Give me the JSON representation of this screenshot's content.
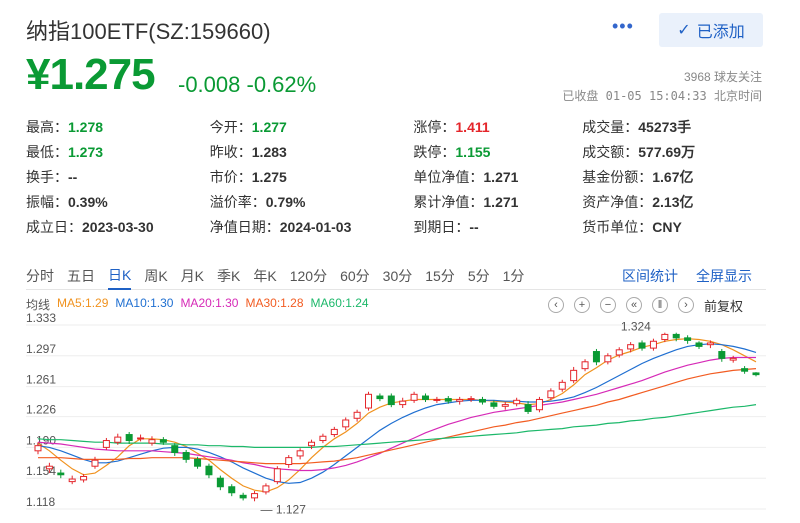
{
  "header": {
    "title": "纳指100ETF(SZ:159660)",
    "more_label": "•••",
    "added_label": "已添加",
    "price": "¥1.275",
    "change": "-0.008  -0.62%",
    "followers": "3968 球友关注",
    "status": "已收盘 01-05 15:04:33 北京时间"
  },
  "stats": [
    [
      {
        "l": "最高：",
        "v": "1.278",
        "c": "green"
      },
      {
        "l": "今开：",
        "v": "1.277",
        "c": "green"
      },
      {
        "l": "涨停：",
        "v": "1.411",
        "c": "red"
      },
      {
        "l": "成交量：",
        "v": "45273手",
        "c": ""
      }
    ],
    [
      {
        "l": "最低：",
        "v": "1.273",
        "c": "green"
      },
      {
        "l": "昨收：",
        "v": "1.283",
        "c": ""
      },
      {
        "l": "跌停：",
        "v": "1.155",
        "c": "green"
      },
      {
        "l": "成交额：",
        "v": "577.69万",
        "c": ""
      }
    ],
    [
      {
        "l": "换手：",
        "v": "--",
        "c": ""
      },
      {
        "l": "市价：",
        "v": "1.275",
        "c": ""
      },
      {
        "l": "单位净值：",
        "v": "1.271",
        "c": ""
      },
      {
        "l": "基金份额：",
        "v": "1.67亿",
        "c": ""
      }
    ],
    [
      {
        "l": "振幅：",
        "v": "0.39%",
        "c": ""
      },
      {
        "l": "溢价率：",
        "v": "0.79%",
        "c": ""
      },
      {
        "l": "累计净值：",
        "v": "1.271",
        "c": ""
      },
      {
        "l": "资产净值：",
        "v": "2.13亿",
        "c": ""
      }
    ],
    [
      {
        "l": "成立日：",
        "v": "2023-03-30",
        "c": ""
      },
      {
        "l": "净值日期：",
        "v": "2024-01-03",
        "c": ""
      },
      {
        "l": "到期日：",
        "v": "--",
        "c": ""
      },
      {
        "l": "货币单位：",
        "v": "CNY",
        "c": ""
      }
    ]
  ],
  "tabs": [
    "分时",
    "五日",
    "日K",
    "周K",
    "月K",
    "季K",
    "年K",
    "120分",
    "60分",
    "30分",
    "15分",
    "5分",
    "1分"
  ],
  "active_tab": 2,
  "tab_links": {
    "interval_stats": "区间统计",
    "fullscreen": "全屏显示"
  },
  "legend": [
    {
      "label": "均线",
      "color": "#555555"
    },
    {
      "label": "MA5:1.29",
      "color": "#f0921e"
    },
    {
      "label": "MA10:1.30",
      "color": "#1f6fd1"
    },
    {
      "label": "MA20:1.30",
      "color": "#d62ab7"
    },
    {
      "label": "MA30:1.28",
      "color": "#f25c22"
    },
    {
      "label": "MA60:1.24",
      "color": "#1cb86a"
    }
  ],
  "tools": {
    "prev": "‹",
    "zoom_in": "+",
    "zoom_out": "−",
    "start": "«",
    "pause": "‖",
    "next": "›",
    "adjust": "前复权"
  },
  "chart_data": {
    "type": "candlestick",
    "y_ticks": [
      "1.333",
      "1.297",
      "1.261",
      "1.226",
      "1.190",
      "1.154",
      "1.118"
    ],
    "ylim": [
      1.118,
      1.333
    ],
    "annotations": [
      {
        "label": "1.324",
        "value": 1.324
      },
      {
        "label": "1.127",
        "value": 1.127
      }
    ],
    "candles": [
      [
        1.186,
        1.192,
        1.182,
        1.196
      ],
      [
        1.165,
        1.168,
        1.16,
        1.172
      ],
      [
        1.16,
        1.158,
        1.154,
        1.164
      ],
      [
        1.15,
        1.153,
        1.147,
        1.157
      ],
      [
        1.152,
        1.156,
        1.149,
        1.159
      ],
      [
        1.168,
        1.175,
        1.165,
        1.179
      ],
      [
        1.19,
        1.198,
        1.187,
        1.201
      ],
      [
        1.196,
        1.202,
        1.193,
        1.206
      ],
      [
        1.205,
        1.198,
        1.194,
        1.208
      ],
      [
        1.2,
        1.201,
        1.197,
        1.205
      ],
      [
        1.195,
        1.199,
        1.192,
        1.203
      ],
      [
        1.199,
        1.196,
        1.193,
        1.202
      ],
      [
        1.192,
        1.184,
        1.18,
        1.195
      ],
      [
        1.184,
        1.176,
        1.172,
        1.187
      ],
      [
        1.176,
        1.168,
        1.165,
        1.179
      ],
      [
        1.168,
        1.158,
        1.154,
        1.171
      ],
      [
        1.154,
        1.144,
        1.14,
        1.157
      ],
      [
        1.144,
        1.137,
        1.133,
        1.147
      ],
      [
        1.134,
        1.131,
        1.128,
        1.137
      ],
      [
        1.131,
        1.136,
        1.127,
        1.139
      ],
      [
        1.138,
        1.145,
        1.135,
        1.148
      ],
      [
        1.15,
        1.165,
        1.147,
        1.168
      ],
      [
        1.17,
        1.178,
        1.166,
        1.181
      ],
      [
        1.18,
        1.186,
        1.176,
        1.189
      ],
      [
        1.192,
        1.196,
        1.188,
        1.199
      ],
      [
        1.198,
        1.203,
        1.195,
        1.206
      ],
      [
        1.205,
        1.211,
        1.202,
        1.214
      ],
      [
        1.214,
        1.222,
        1.21,
        1.225
      ],
      [
        1.224,
        1.231,
        1.22,
        1.234
      ],
      [
        1.236,
        1.252,
        1.233,
        1.255
      ],
      [
        1.25,
        1.247,
        1.244,
        1.253
      ],
      [
        1.25,
        1.24,
        1.237,
        1.253
      ],
      [
        1.24,
        1.244,
        1.236,
        1.248
      ],
      [
        1.245,
        1.252,
        1.242,
        1.255
      ],
      [
        1.25,
        1.246,
        1.243,
        1.253
      ],
      [
        1.245,
        1.246,
        1.242,
        1.249
      ],
      [
        1.247,
        1.244,
        1.241,
        1.25
      ],
      [
        1.244,
        1.246,
        1.24,
        1.249
      ],
      [
        1.246,
        1.247,
        1.243,
        1.25
      ],
      [
        1.246,
        1.243,
        1.24,
        1.249
      ],
      [
        1.242,
        1.238,
        1.235,
        1.245
      ],
      [
        1.238,
        1.24,
        1.234,
        1.243
      ],
      [
        1.241,
        1.245,
        1.238,
        1.248
      ],
      [
        1.24,
        1.232,
        1.229,
        1.244
      ],
      [
        1.234,
        1.246,
        1.231,
        1.249
      ],
      [
        1.248,
        1.256,
        1.245,
        1.259
      ],
      [
        1.258,
        1.266,
        1.255,
        1.269
      ],
      [
        1.268,
        1.28,
        1.265,
        1.284
      ],
      [
        1.282,
        1.29,
        1.279,
        1.293
      ],
      [
        1.302,
        1.29,
        1.286,
        1.305
      ],
      [
        1.29,
        1.297,
        1.287,
        1.3
      ],
      [
        1.298,
        1.304,
        1.295,
        1.307
      ],
      [
        1.305,
        1.31,
        1.301,
        1.313
      ],
      [
        1.312,
        1.306,
        1.303,
        1.315
      ],
      [
        1.306,
        1.314,
        1.303,
        1.317
      ],
      [
        1.316,
        1.322,
        1.313,
        1.324
      ],
      [
        1.322,
        1.318,
        1.314,
        1.324
      ],
      [
        1.318,
        1.315,
        1.311,
        1.321
      ],
      [
        1.312,
        1.308,
        1.305,
        1.314
      ],
      [
        1.31,
        1.312,
        1.306,
        1.315
      ],
      [
        1.302,
        1.294,
        1.29,
        1.305
      ],
      [
        1.292,
        1.294,
        1.289,
        1.297
      ],
      [
        1.282,
        1.279,
        1.276,
        1.285
      ],
      [
        1.277,
        1.275,
        1.273,
        1.278
      ]
    ],
    "ma": {
      "MA5": [
        1.195,
        1.186,
        1.175,
        1.165,
        1.158,
        1.16,
        1.169,
        1.179,
        1.192,
        1.2,
        1.2,
        1.199,
        1.196,
        1.191,
        1.183,
        1.175,
        1.164,
        1.154,
        1.145,
        1.14,
        1.138,
        1.143,
        1.152,
        1.164,
        1.178,
        1.19,
        1.2,
        1.208,
        1.218,
        1.23,
        1.237,
        1.242,
        1.244,
        1.246,
        1.246,
        1.246,
        1.246,
        1.246,
        1.246,
        1.245,
        1.244,
        1.243,
        1.242,
        1.24,
        1.241,
        1.246,
        1.253,
        1.263,
        1.275,
        1.283,
        1.292,
        1.298,
        1.302,
        1.307,
        1.31,
        1.314,
        1.316,
        1.317,
        1.316,
        1.314,
        1.31,
        1.304,
        1.297,
        1.29
      ],
      "MA10": [
        1.192,
        1.19,
        1.186,
        1.181,
        1.176,
        1.172,
        1.172,
        1.174,
        1.178,
        1.182,
        1.186,
        1.189,
        1.19,
        1.19,
        1.188,
        1.184,
        1.179,
        1.173,
        1.166,
        1.16,
        1.154,
        1.15,
        1.148,
        1.149,
        1.154,
        1.161,
        1.17,
        1.18,
        1.19,
        1.2,
        1.21,
        1.218,
        1.225,
        1.231,
        1.236,
        1.24,
        1.242,
        1.244,
        1.245,
        1.245,
        1.245,
        1.244,
        1.244,
        1.243,
        1.243,
        1.244,
        1.246,
        1.249,
        1.254,
        1.26,
        1.267,
        1.274,
        1.281,
        1.288,
        1.294,
        1.299,
        1.304,
        1.308,
        1.31,
        1.311,
        1.31,
        1.308,
        1.305,
        1.301
      ],
      "MA20": [
        1.196,
        1.195,
        1.194,
        1.192,
        1.19,
        1.188,
        1.187,
        1.186,
        1.186,
        1.186,
        1.186,
        1.185,
        1.184,
        1.183,
        1.181,
        1.179,
        1.177,
        1.175,
        1.172,
        1.17,
        1.167,
        1.165,
        1.164,
        1.163,
        1.163,
        1.164,
        1.166,
        1.169,
        1.173,
        1.178,
        1.183,
        1.189,
        1.195,
        1.201,
        1.207,
        1.212,
        1.217,
        1.221,
        1.225,
        1.228,
        1.231,
        1.233,
        1.235,
        1.237,
        1.239,
        1.241,
        1.243,
        1.246,
        1.249,
        1.252,
        1.256,
        1.26,
        1.264,
        1.268,
        1.273,
        1.278,
        1.282,
        1.286,
        1.289,
        1.292,
        1.294,
        1.295,
        1.295,
        1.295
      ],
      "MA30": [
        1.178,
        1.178,
        1.178,
        1.177,
        1.176,
        1.176,
        1.176,
        1.176,
        1.177,
        1.177,
        1.178,
        1.178,
        1.178,
        1.178,
        1.177,
        1.176,
        1.175,
        1.174,
        1.173,
        1.172,
        1.171,
        1.171,
        1.171,
        1.171,
        1.172,
        1.173,
        1.174,
        1.176,
        1.178,
        1.181,
        1.184,
        1.187,
        1.19,
        1.193,
        1.196,
        1.199,
        1.202,
        1.205,
        1.208,
        1.211,
        1.214,
        1.216,
        1.219,
        1.221,
        1.224,
        1.227,
        1.23,
        1.233,
        1.236,
        1.239,
        1.243,
        1.246,
        1.25,
        1.254,
        1.258,
        1.262,
        1.266,
        1.27,
        1.273,
        1.276,
        1.278,
        1.28,
        1.281,
        1.282
      ],
      "MA60": [
        1.2,
        1.199,
        1.199,
        1.198,
        1.197,
        1.196,
        1.196,
        1.195,
        1.195,
        1.195,
        1.195,
        1.194,
        1.194,
        1.193,
        1.193,
        1.192,
        1.192,
        1.191,
        1.191,
        1.19,
        1.19,
        1.19,
        1.19,
        1.19,
        1.19,
        1.191,
        1.191,
        1.192,
        1.193,
        1.194,
        1.195,
        1.196,
        1.197,
        1.198,
        1.199,
        1.2,
        1.201,
        1.202,
        1.203,
        1.204,
        1.205,
        1.206,
        1.207,
        1.209,
        1.21,
        1.211,
        1.212,
        1.214,
        1.215,
        1.216,
        1.218,
        1.219,
        1.221,
        1.222,
        1.224,
        1.225,
        1.227,
        1.229,
        1.231,
        1.233,
        1.235,
        1.237,
        1.238,
        1.24
      ]
    }
  }
}
